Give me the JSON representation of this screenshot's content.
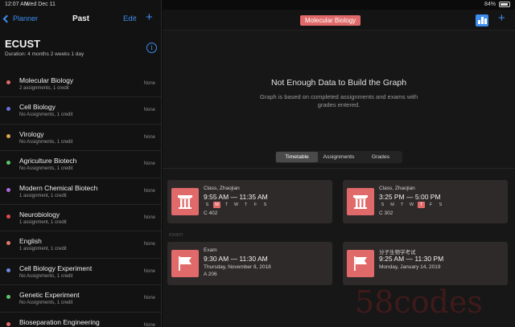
{
  "status": {
    "time": "12:07 AM",
    "date": "Wed Dec 11",
    "battery": "84%"
  },
  "sidebar": {
    "back_label": "Planner",
    "title": "Past",
    "edit_label": "Edit",
    "add_label": "+",
    "school": "ECUST",
    "duration": "Duration: 4 months 2 weeks 1 day",
    "info_label": "i",
    "courses": [
      {
        "name": "Molecular Biology",
        "sub": "2 assignments, 1 credit",
        "grade": "None",
        "color": "#e06a69"
      },
      {
        "name": "Cell Biology",
        "sub": "No Assignments, 1 credit",
        "grade": "None",
        "color": "#6a6fe0"
      },
      {
        "name": "Virology",
        "sub": "No Assignments, 1 credit",
        "grade": "None",
        "color": "#e0a64a"
      },
      {
        "name": "Agriculture Biotech",
        "sub": "No Assignments, 1 credit",
        "grade": "None",
        "color": "#5ec46a"
      },
      {
        "name": "Modern Chemical Biotech",
        "sub": "1 assignment, 1 credit",
        "grade": "None",
        "color": "#b06ae0"
      },
      {
        "name": "Neurobiology",
        "sub": "1 assignment, 1 credit",
        "grade": "None",
        "color": "#e04a4a"
      },
      {
        "name": "English",
        "sub": "1 assignment, 1 credit",
        "grade": "None",
        "color": "#e07a6a"
      },
      {
        "name": "Cell Biology Experiment",
        "sub": "No Assignments, 1 credit",
        "grade": "None",
        "color": "#6a8ae0"
      },
      {
        "name": "Genetic Experiment",
        "sub": "No Assignments, 1 credit",
        "grade": "None",
        "color": "#5ec46a"
      },
      {
        "name": "Bioseparation Engineering",
        "sub": "",
        "grade": "None",
        "color": "#e06a69"
      }
    ]
  },
  "main": {
    "course_title": "Molecular Biology",
    "add_label": "+",
    "nodata_title": "Not Enough Data to Build the Graph",
    "nodata_desc": "Graph is based on completed assignments and exams with grades entered.",
    "tabs": [
      "Timetable",
      "Assignments",
      "Grades"
    ],
    "active_tab": "Timetable",
    "classes": [
      {
        "kind": "Class, Zhaojian",
        "time": "9:55 AM — 11:35 AM",
        "days": [
          "S",
          "M",
          "T",
          "W",
          "T",
          "F",
          "S"
        ],
        "active_day": 1,
        "room": "C 402"
      },
      {
        "kind": "Class, Zhaojian",
        "time": "3:25 PM — 5:00 PM",
        "days": [
          "S",
          "M",
          "T",
          "W",
          "T",
          "F",
          "S"
        ],
        "active_day": 4,
        "room": "C 302"
      }
    ],
    "exam_label": "exam",
    "exams": [
      {
        "kind": "Exam",
        "time": "9:30 AM — 11:30 AM",
        "date": "Thursday, November 8, 2018",
        "room": "A 206"
      },
      {
        "kind": "分子生物学考试",
        "time": "9:25 AM — 11:30 PM",
        "date": "Monday, January 14, 2019",
        "room": ""
      }
    ]
  },
  "watermark": "58codes"
}
